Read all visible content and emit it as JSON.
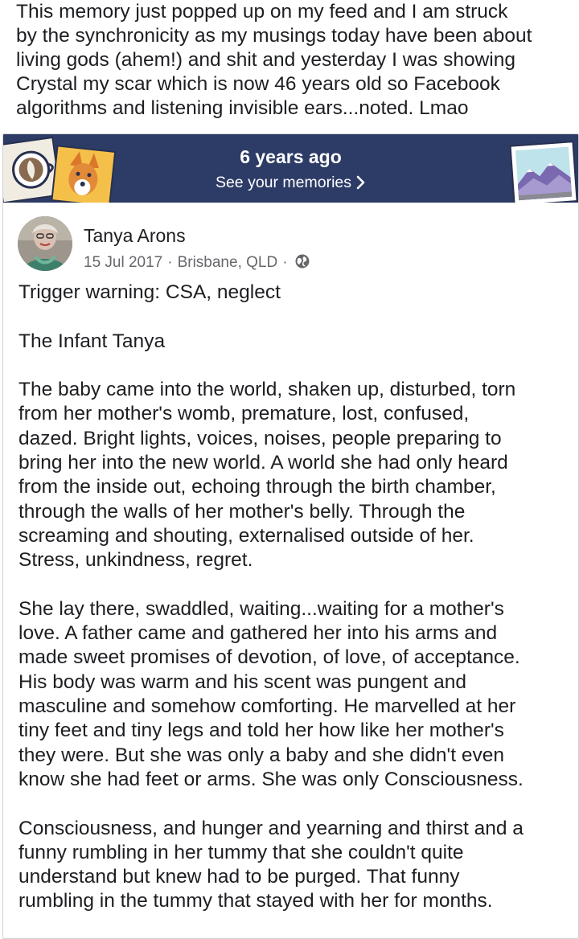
{
  "caption": {
    "lines": [
      "This memory just popped up on my feed and I am struck",
      "by the synchronicity as my musings today have been about",
      "living gods (ahem!) and shit and yesterday I was showing",
      "Crystal my scar which is now 46 years old so Facebook",
      "algorithms and listening invisible ears...noted.  Lmao"
    ]
  },
  "memory_banner": {
    "title": "6 years ago",
    "link_label": "See your memories",
    "background_color": "#2d3c66",
    "left_decoration_icon": "coffee-cup-and-dog-photo-icon",
    "right_decoration_icon": "mountain-photo-icon",
    "chevron_icon": "chevron-right-icon"
  },
  "post": {
    "author_name": "Tanya Arons",
    "date": "15 Jul 2017",
    "location": "Brisbane, QLD",
    "separator": "·",
    "privacy_icon": "globe-icon",
    "paragraphs": [
      {
        "lines": [
          "Trigger warning:  CSA, neglect"
        ]
      },
      {
        "lines": [
          "The Infant Tanya"
        ]
      },
      {
        "lines": [
          "The baby came into the world, shaken up, disturbed, torn",
          "from her mother's womb, premature, lost, confused,",
          "dazed.  Bright lights, voices, noises, people preparing to",
          "bring her into the new world.  A world she had only heard",
          "from the inside out, echoing through the birth chamber,",
          "through the walls of her mother's belly.  Through the",
          "screaming and shouting, externalised outside of her.",
          "Stress, unkindness, regret."
        ]
      },
      {
        "lines": [
          "She lay there, swaddled, waiting...waiting for a mother's",
          "love.  A father came and gathered her into his arms and",
          "made sweet promises of devotion, of love, of acceptance.",
          "His body was warm and his scent was pungent and",
          "masculine and somehow comforting.  He marvelled at her",
          "tiny feet and tiny legs and told her how like her mother's",
          "they were.  But she was only a baby and she didn't even",
          "know she had feet or arms.  She was only Consciousness."
        ]
      },
      {
        "lines": [
          "Consciousness, and hunger and yearning and thirst and a",
          "funny rumbling in her tummy that she couldn't quite",
          "understand but knew had to be purged. That funny",
          "rumbling in the tummy that stayed with her for months."
        ]
      }
    ]
  }
}
